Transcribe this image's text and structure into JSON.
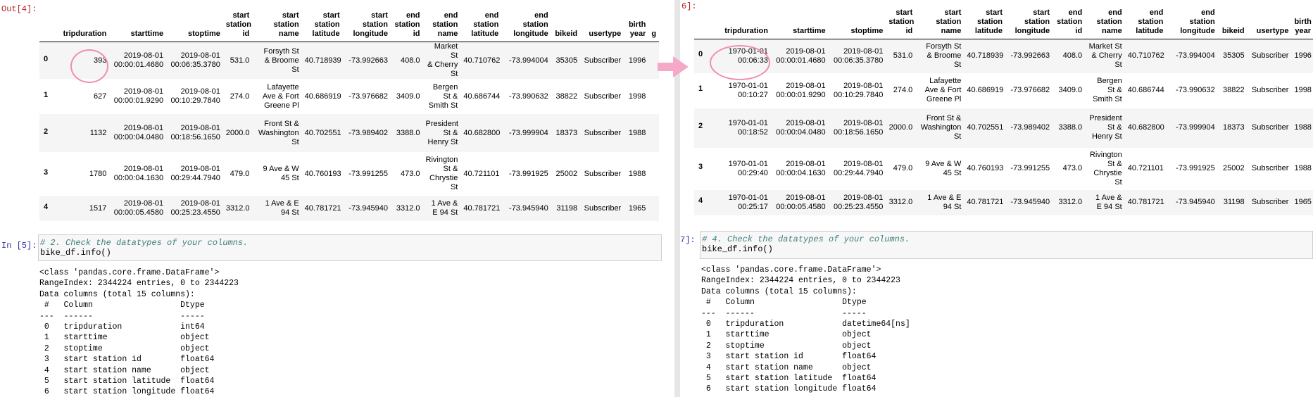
{
  "left": {
    "out_prompt": "Out[4]:",
    "in_prompt": "In [5]:",
    "headers": [
      [
        "tripduration"
      ],
      [
        "starttime"
      ],
      [
        "stoptime"
      ],
      [
        "start",
        "station",
        "id"
      ],
      [
        "start",
        "station",
        "name"
      ],
      [
        "start",
        "station",
        "latitude"
      ],
      [
        "start",
        "station",
        "longitude"
      ],
      [
        "end",
        "station",
        "id"
      ],
      [
        "end",
        "station",
        "name"
      ],
      [
        "end",
        "station",
        "latitude"
      ],
      [
        "end",
        "station",
        "longitude"
      ],
      [
        "bikeid"
      ],
      [
        "usertype"
      ],
      [
        "birth",
        "year"
      ],
      [
        "g"
      ]
    ],
    "rows": [
      {
        "idx": "0",
        "cells": [
          [
            "393"
          ],
          [
            "2019-08-01",
            "00:00:01.4680"
          ],
          [
            "2019-08-01",
            "00:06:35.3780"
          ],
          [
            "531.0"
          ],
          [
            "Forsyth St",
            "& Broome",
            "St"
          ],
          [
            "40.718939"
          ],
          [
            "-73.992663"
          ],
          [
            "408.0"
          ],
          [
            "Market St",
            "& Cherry",
            "St"
          ],
          [
            "40.710762"
          ],
          [
            "-73.994004"
          ],
          [
            "35305"
          ],
          [
            "Subscriber"
          ],
          [
            "1996"
          ],
          [
            ""
          ]
        ]
      },
      {
        "idx": "1",
        "cells": [
          [
            "627"
          ],
          [
            "2019-08-01",
            "00:00:01.9290"
          ],
          [
            "2019-08-01",
            "00:10:29.7840"
          ],
          [
            "274.0"
          ],
          [
            "Lafayette",
            "Ave & Fort",
            "Greene Pl"
          ],
          [
            "40.686919"
          ],
          [
            "-73.976682"
          ],
          [
            "3409.0"
          ],
          [
            "Bergen",
            "St &",
            "Smith St"
          ],
          [
            "40.686744"
          ],
          [
            "-73.990632"
          ],
          [
            "38822"
          ],
          [
            "Subscriber"
          ],
          [
            "1998"
          ],
          [
            ""
          ]
        ]
      },
      {
        "idx": "2",
        "cells": [
          [
            "1132"
          ],
          [
            "2019-08-01",
            "00:00:04.0480"
          ],
          [
            "2019-08-01",
            "00:18:56.1650"
          ],
          [
            "2000.0"
          ],
          [
            "Front St &",
            "Washington",
            "St"
          ],
          [
            "40.702551"
          ],
          [
            "-73.989402"
          ],
          [
            "3388.0"
          ],
          [
            "President",
            "St &",
            "Henry St"
          ],
          [
            "40.682800"
          ],
          [
            "-73.999904"
          ],
          [
            "18373"
          ],
          [
            "Subscriber"
          ],
          [
            "1988"
          ],
          [
            ""
          ]
        ]
      },
      {
        "idx": "3",
        "cells": [
          [
            "1780"
          ],
          [
            "2019-08-01",
            "00:00:04.1630"
          ],
          [
            "2019-08-01",
            "00:29:44.7940"
          ],
          [
            "479.0"
          ],
          [
            "9 Ave & W",
            "45 St"
          ],
          [
            "40.760193"
          ],
          [
            "-73.991255"
          ],
          [
            "473.0"
          ],
          [
            "Rivington",
            "St &",
            "Chrystie",
            "St"
          ],
          [
            "40.721101"
          ],
          [
            "-73.991925"
          ],
          [
            "25002"
          ],
          [
            "Subscriber"
          ],
          [
            "1988"
          ],
          [
            ""
          ]
        ]
      },
      {
        "idx": "4",
        "cells": [
          [
            "1517"
          ],
          [
            "2019-08-01",
            "00:00:05.4580"
          ],
          [
            "2019-08-01",
            "00:25:23.4550"
          ],
          [
            "3312.0"
          ],
          [
            "1 Ave & E",
            "94 St"
          ],
          [
            "40.781721"
          ],
          [
            "-73.945940"
          ],
          [
            "3312.0"
          ],
          [
            "1 Ave &",
            "E 94 St"
          ],
          [
            "40.781721"
          ],
          [
            "-73.945940"
          ],
          [
            "31198"
          ],
          [
            "Subscriber"
          ],
          [
            "1965"
          ],
          [
            ""
          ]
        ]
      }
    ],
    "code_comment": "# 2. Check the datatypes of your columns.",
    "code_line": "bike_df.info()",
    "info_output": "<class 'pandas.core.frame.DataFrame'>\nRangeIndex: 2344224 entries, 0 to 2344223\nData columns (total 15 columns):\n #   Column                  Dtype  \n---  ------                  -----  \n 0   tripduration            int64  \n 1   starttime               object \n 2   stoptime                object \n 3   start station id        float64\n 4   start station name      object \n 5   start station latitude  float64\n 6   start station longitude float64"
  },
  "right": {
    "out_prompt": "6]:",
    "in_prompt": "7]:",
    "headers": [
      [
        "tripduration"
      ],
      [
        "starttime"
      ],
      [
        "stoptime"
      ],
      [
        "start",
        "station",
        "id"
      ],
      [
        "start",
        "station",
        "name"
      ],
      [
        "start",
        "station",
        "latitude"
      ],
      [
        "start",
        "station",
        "longitude"
      ],
      [
        "end",
        "station",
        "id"
      ],
      [
        "end",
        "station",
        "name"
      ],
      [
        "end",
        "station",
        "latitude"
      ],
      [
        "end",
        "station",
        "longitude"
      ],
      [
        "bikeid"
      ],
      [
        "usertype"
      ],
      [
        "birth",
        "year"
      ]
    ],
    "rows": [
      {
        "idx": "0",
        "cells": [
          [
            "1970-01-01",
            "00:06:33"
          ],
          [
            "2019-08-01",
            "00:00:01.4680"
          ],
          [
            "2019-08-01",
            "00:06:35.3780"
          ],
          [
            "531.0"
          ],
          [
            "Forsyth St",
            "& Broome",
            "St"
          ],
          [
            "40.718939"
          ],
          [
            "-73.992663"
          ],
          [
            "408.0"
          ],
          [
            "Market St",
            "& Cherry",
            "St"
          ],
          [
            "40.710762"
          ],
          [
            "-73.994004"
          ],
          [
            "35305"
          ],
          [
            "Subscriber"
          ],
          [
            "1996"
          ]
        ]
      },
      {
        "idx": "1",
        "cells": [
          [
            "1970-01-01",
            "00:10:27"
          ],
          [
            "2019-08-01",
            "00:00:01.9290"
          ],
          [
            "2019-08-01",
            "00:10:29.7840"
          ],
          [
            "274.0"
          ],
          [
            "Lafayette",
            "Ave & Fort",
            "Greene Pl"
          ],
          [
            "40.686919"
          ],
          [
            "-73.976682"
          ],
          [
            "3409.0"
          ],
          [
            "Bergen",
            "St &",
            "Smith St"
          ],
          [
            "40.686744"
          ],
          [
            "-73.990632"
          ],
          [
            "38822"
          ],
          [
            "Subscriber"
          ],
          [
            "1998"
          ]
        ]
      },
      {
        "idx": "2",
        "cells": [
          [
            "1970-01-01",
            "00:18:52"
          ],
          [
            "2019-08-01",
            "00:00:04.0480"
          ],
          [
            "2019-08-01",
            "00:18:56.1650"
          ],
          [
            "2000.0"
          ],
          [
            "Front St &",
            "Washington",
            "St"
          ],
          [
            "40.702551"
          ],
          [
            "-73.989402"
          ],
          [
            "3388.0"
          ],
          [
            "President",
            "St &",
            "Henry St"
          ],
          [
            "40.682800"
          ],
          [
            "-73.999904"
          ],
          [
            "18373"
          ],
          [
            "Subscriber"
          ],
          [
            "1988"
          ]
        ]
      },
      {
        "idx": "3",
        "cells": [
          [
            "1970-01-01",
            "00:29:40"
          ],
          [
            "2019-08-01",
            "00:00:04.1630"
          ],
          [
            "2019-08-01",
            "00:29:44.7940"
          ],
          [
            "479.0"
          ],
          [
            "9 Ave & W",
            "45 St"
          ],
          [
            "40.760193"
          ],
          [
            "-73.991255"
          ],
          [
            "473.0"
          ],
          [
            "Rivington",
            "St &",
            "Chrystie",
            "St"
          ],
          [
            "40.721101"
          ],
          [
            "-73.991925"
          ],
          [
            "25002"
          ],
          [
            "Subscriber"
          ],
          [
            "1988"
          ]
        ]
      },
      {
        "idx": "4",
        "cells": [
          [
            "1970-01-01",
            "00:25:17"
          ],
          [
            "2019-08-01",
            "00:00:05.4580"
          ],
          [
            "2019-08-01",
            "00:25:23.4550"
          ],
          [
            "3312.0"
          ],
          [
            "1 Ave & E",
            "94 St"
          ],
          [
            "40.781721"
          ],
          [
            "-73.945940"
          ],
          [
            "3312.0"
          ],
          [
            "1 Ave &",
            "E 94 St"
          ],
          [
            "40.781721"
          ],
          [
            "-73.945940"
          ],
          [
            "31198"
          ],
          [
            "Subscriber"
          ],
          [
            "1965"
          ]
        ]
      }
    ],
    "code_comment": "# 4. Check the datatypes of your columns.",
    "code_line": "bike_df.info()",
    "info_output": "<class 'pandas.core.frame.DataFrame'>\nRangeIndex: 2344224 entries, 0 to 2344223\nData columns (total 15 columns):\n #   Column                  Dtype         \n---  ------                  -----         \n 0   tripduration            datetime64[ns]\n 1   starttime               object        \n 2   stoptime                object        \n 3   start station id        float64       \n 4   start station name      object        \n 5   start station latitude  float64       \n 6   start station longitude float64"
  },
  "colors": {
    "annotation": "#f28db5",
    "out_prompt": "#b22222",
    "in_prompt": "#30309f",
    "comment": "#408080"
  }
}
